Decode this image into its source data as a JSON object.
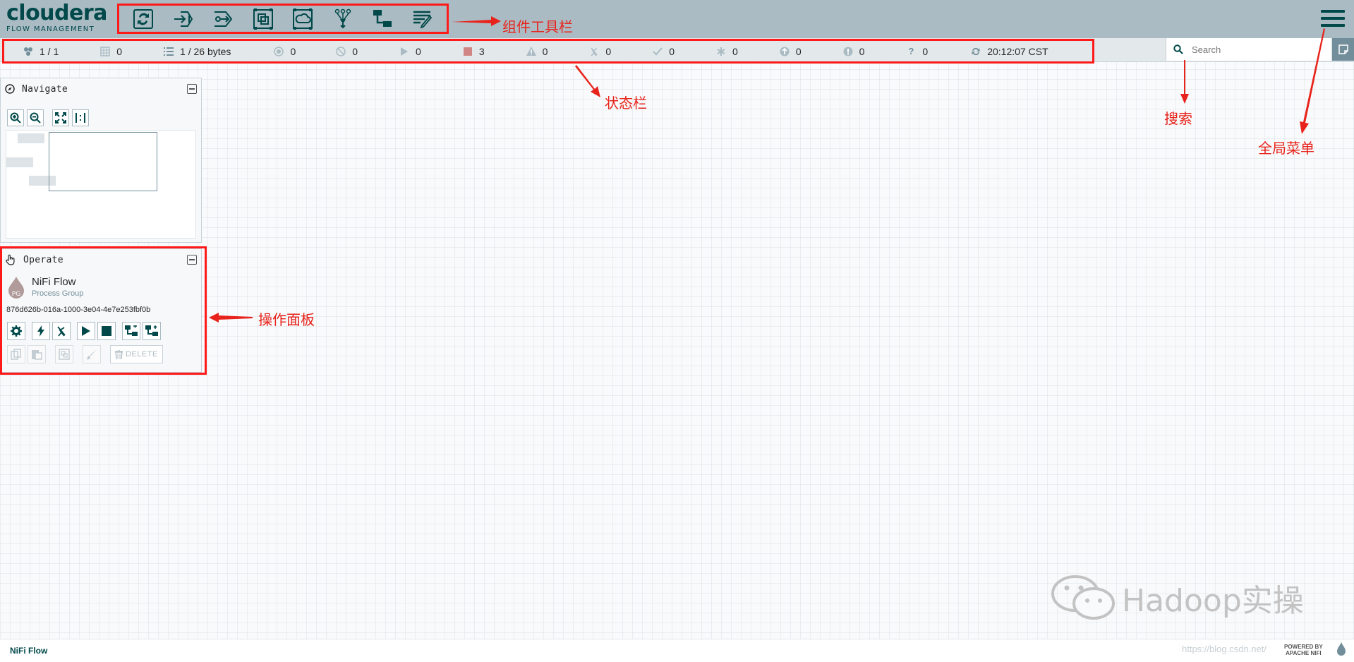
{
  "brand": {
    "name": "cloudera",
    "product": "FLOW MANAGEMENT"
  },
  "toolbar": {
    "tools": [
      {
        "id": "processor",
        "icon": "processor-icon"
      },
      {
        "id": "input-port",
        "icon": "input-port-icon"
      },
      {
        "id": "output-port",
        "icon": "output-port-icon"
      },
      {
        "id": "process-group",
        "icon": "process-group-icon"
      },
      {
        "id": "remote-process-group",
        "icon": "remote-process-group-icon"
      },
      {
        "id": "funnel",
        "icon": "funnel-icon"
      },
      {
        "id": "template",
        "icon": "template-icon"
      },
      {
        "id": "label",
        "icon": "label-icon"
      }
    ]
  },
  "status": {
    "threads": "1 / 1",
    "tasks": "0",
    "queued": "1 / 26 bytes",
    "transmitting": "0",
    "not_transmitting": "0",
    "running": "0",
    "stopped": "3",
    "invalid": "0",
    "disabled": "0",
    "up_to_date": "0",
    "locally_modified": "0",
    "stale": "0",
    "locally_modified_stale": "0",
    "sync_failure": "0",
    "last_refreshed": "20:12:07 CST"
  },
  "search": {
    "placeholder": "Search"
  },
  "navigate": {
    "title": "Navigate"
  },
  "operate": {
    "title": "Operate",
    "component_name": "NiFi Flow",
    "component_type": "Process Group",
    "component_id": "876d626b-016a-1000-3e04-4e7e253fbf0b",
    "delete_label": "DELETE"
  },
  "annotations": {
    "toolbar": "组件工具栏",
    "statusbar": "状态栏",
    "search": "搜索",
    "global_menu": "全局菜单",
    "operate": "操作面板"
  },
  "footer": {
    "breadcrumb": "NiFi Flow"
  },
  "watermark": {
    "account": "Hadoop实操",
    "url": "https://blog.csdn.net/",
    "powered_by": "POWERED BY",
    "powered_name": "APACHE NIFI"
  },
  "colors": {
    "header": "#aabbc3",
    "accent": "#004849",
    "annotation": "#e8231b",
    "stopped": "#d18686"
  }
}
